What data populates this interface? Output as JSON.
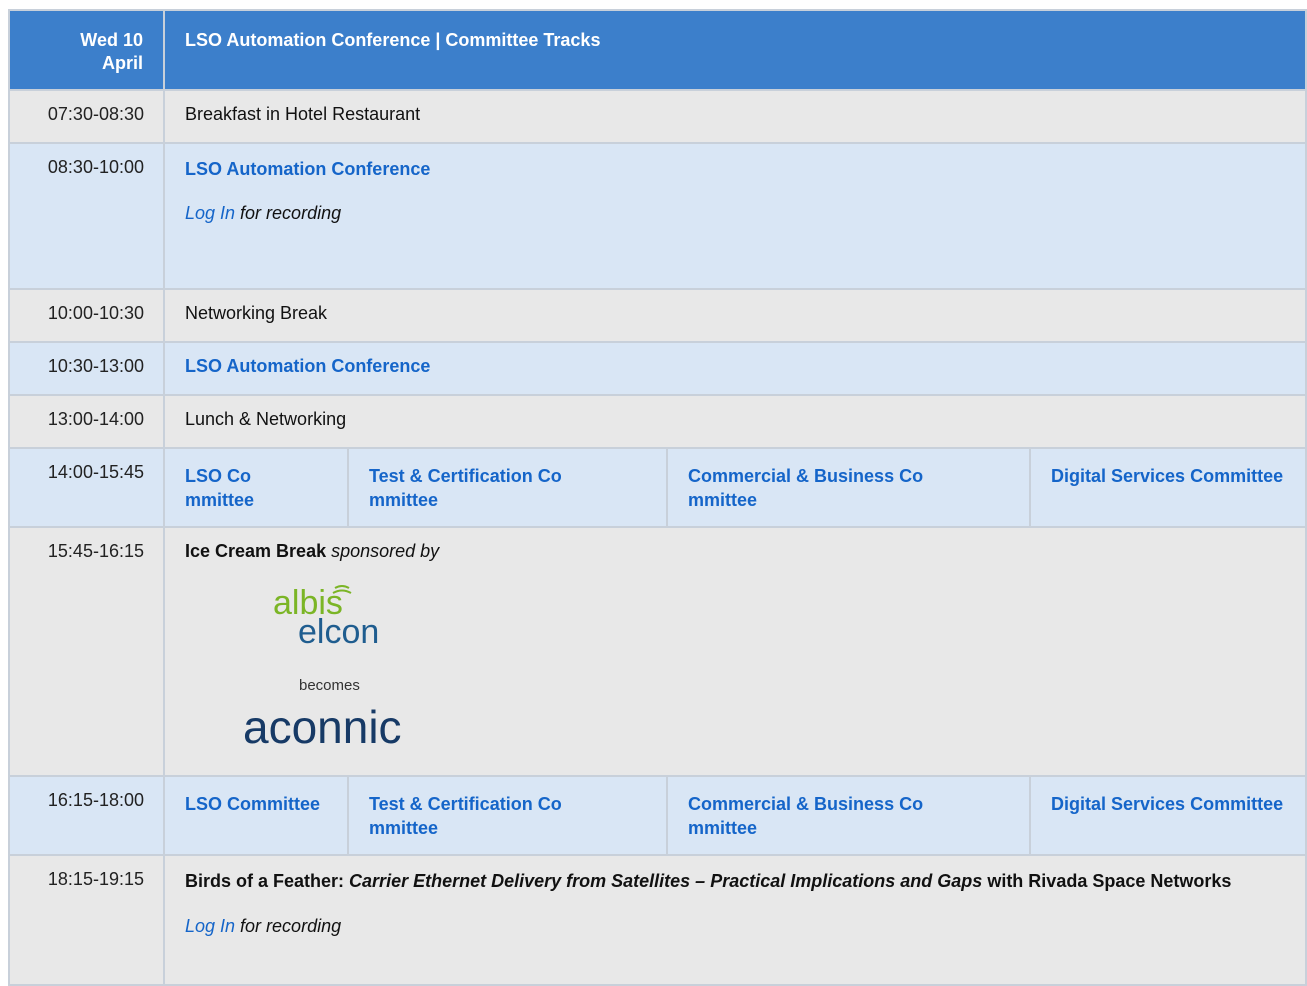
{
  "header": {
    "date": "Wed 10 April",
    "date_line1": "Wed 10",
    "date_line2": "April",
    "title": "LSO Automation Conference | Committee Tracks"
  },
  "rows": [
    {
      "time": "07:30-08:30",
      "text": "Breakfast in Hotel Restaurant"
    },
    {
      "time": "08:30-10:00",
      "link": "LSO Automation Conference",
      "login": "Log In",
      "login_suffix": " for recording"
    },
    {
      "time": "10:00-10:30",
      "text": "Networking Break"
    },
    {
      "time": "10:30-13:00",
      "link": "LSO Automation Conference"
    },
    {
      "time": "13:00-14:00",
      "text": "Lunch & Networking"
    },
    {
      "time": "14:00-15:45",
      "tracks": [
        "LSO Committee",
        "Test & Certification Committee",
        "Commercial & Business Committee",
        "Digital Services Committee"
      ]
    },
    {
      "time": "15:45-16:15",
      "bold": "Ice Cream Break",
      "italic": " sponsored by",
      "logo": {
        "line1": "albis",
        "line2": "elcon",
        "becomes": "becomes",
        "new_name": "aconnic"
      }
    },
    {
      "time": "16:15-18:00",
      "tracks": [
        "LSO Committee",
        "Test & Certification Committee",
        "Commercial & Business Committee",
        "Digital Services Committee"
      ]
    },
    {
      "time": "18:15-19:15",
      "bof_prefix": "Birds of a Feather:",
      "bof_title": "Carrier Ethernet Delivery from Satellites – Practical Implications and Gaps",
      "bof_suffix": "with Rivada Space Networks",
      "login": "Log In",
      "login_suffix": " for recording"
    }
  ],
  "colors": {
    "header_bg": "#3c7fcb",
    "blue_row": "#d9e6f5",
    "grey_row": "#e8e8e8",
    "link": "#1565c9",
    "logo_green": "#7bb526",
    "logo_blue": "#1f5d8f",
    "logo_navy": "#173a66"
  }
}
